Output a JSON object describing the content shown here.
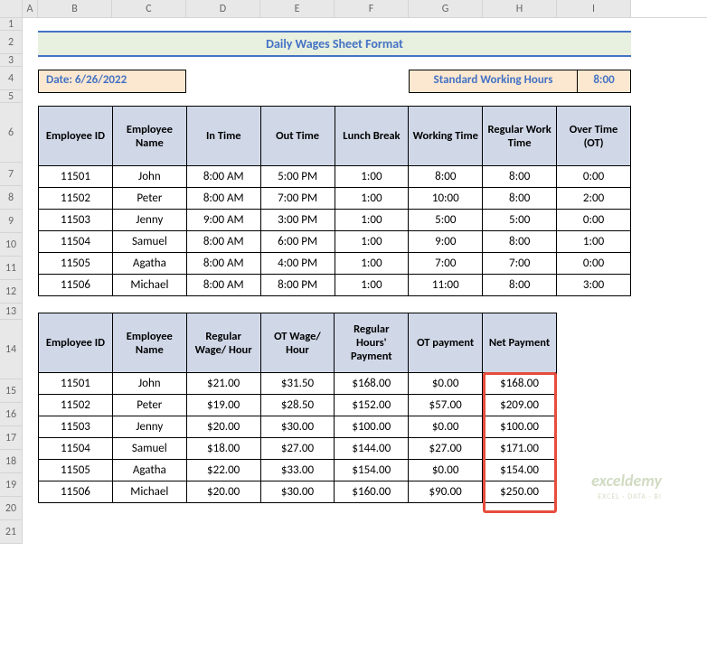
{
  "columns": [
    "A",
    "B",
    "C",
    "D",
    "E",
    "F",
    "G",
    "H",
    "I"
  ],
  "rowNums": [
    "1",
    "2",
    "3",
    "4",
    "5",
    "6",
    "7",
    "8",
    "9",
    "10",
    "11",
    "12",
    "13",
    "14",
    "15",
    "16",
    "17",
    "18",
    "19",
    "20",
    "21"
  ],
  "title": "Daily Wages Sheet Format",
  "dateLabel": "Date: 6/26/2022",
  "stdHoursLabel": "Standard Working Hours",
  "stdHoursValue": "8:00",
  "table1": {
    "headers": [
      "Employee ID",
      "Employee Name",
      "In Time",
      "Out Time",
      "Lunch Break",
      "Working Time",
      "Regular Work Time",
      "Over Time (OT)"
    ],
    "rows": [
      [
        "11501",
        "John",
        "8:00 AM",
        "5:00 PM",
        "1:00",
        "8:00",
        "8:00",
        "0:00"
      ],
      [
        "11502",
        "Peter",
        "8:00 AM",
        "7:00 PM",
        "1:00",
        "10:00",
        "8:00",
        "2:00"
      ],
      [
        "11503",
        "Jenny",
        "9:00 AM",
        "3:00 PM",
        "1:00",
        "5:00",
        "5:00",
        "0:00"
      ],
      [
        "11504",
        "Samuel",
        "8:00 AM",
        "6:00 PM",
        "1:00",
        "9:00",
        "8:00",
        "1:00"
      ],
      [
        "11505",
        "Agatha",
        "8:00 AM",
        "4:00 PM",
        "1:00",
        "7:00",
        "7:00",
        "0:00"
      ],
      [
        "11506",
        "Michael",
        "8:00 AM",
        "8:00 PM",
        "1:00",
        "11:00",
        "8:00",
        "3:00"
      ]
    ]
  },
  "table2": {
    "headers": [
      "Employee ID",
      "Employee Name",
      "Regular Wage/ Hour",
      "OT Wage/ Hour",
      "Regular Hours' Payment",
      "OT payment",
      "Net Payment"
    ],
    "rows": [
      [
        "11501",
        "John",
        "$21.00",
        "$31.50",
        "$168.00",
        "$0.00",
        "$168.00"
      ],
      [
        "11502",
        "Peter",
        "$19.00",
        "$28.50",
        "$152.00",
        "$57.00",
        "$209.00"
      ],
      [
        "11503",
        "Jenny",
        "$20.00",
        "$30.00",
        "$100.00",
        "$0.00",
        "$100.00"
      ],
      [
        "11504",
        "Samuel",
        "$18.00",
        "$27.00",
        "$144.00",
        "$27.00",
        "$171.00"
      ],
      [
        "11505",
        "Agatha",
        "$22.00",
        "$33.00",
        "$154.00",
        "$0.00",
        "$154.00"
      ],
      [
        "11506",
        "Michael",
        "$20.00",
        "$30.00",
        "$160.00",
        "$90.00",
        "$250.00"
      ]
    ]
  },
  "watermark": "exceldemy",
  "watermarkSub": "EXCEL · DATA · BI",
  "chart_data": {
    "type": "table",
    "title": "Daily Wages Sheet Format",
    "tables": [
      {
        "headers": [
          "Employee ID",
          "Employee Name",
          "In Time",
          "Out Time",
          "Lunch Break",
          "Working Time",
          "Regular Work Time",
          "Over Time (OT)"
        ],
        "rows": [
          [
            11501,
            "John",
            "8:00 AM",
            "5:00 PM",
            "1:00",
            "8:00",
            "8:00",
            "0:00"
          ],
          [
            11502,
            "Peter",
            "8:00 AM",
            "7:00 PM",
            "1:00",
            "10:00",
            "8:00",
            "2:00"
          ],
          [
            11503,
            "Jenny",
            "9:00 AM",
            "3:00 PM",
            "1:00",
            "5:00",
            "5:00",
            "0:00"
          ],
          [
            11504,
            "Samuel",
            "8:00 AM",
            "6:00 PM",
            "1:00",
            "9:00",
            "8:00",
            "1:00"
          ],
          [
            11505,
            "Agatha",
            "8:00 AM",
            "4:00 PM",
            "1:00",
            "7:00",
            "7:00",
            "0:00"
          ],
          [
            11506,
            "Michael",
            "8:00 AM",
            "8:00 PM",
            "1:00",
            "11:00",
            "8:00",
            "3:00"
          ]
        ]
      },
      {
        "headers": [
          "Employee ID",
          "Employee Name",
          "Regular Wage/Hour",
          "OT Wage/Hour",
          "Regular Hours' Payment",
          "OT payment",
          "Net Payment"
        ],
        "rows": [
          [
            11501,
            "John",
            21.0,
            31.5,
            168.0,
            0.0,
            168.0
          ],
          [
            11502,
            "Peter",
            19.0,
            28.5,
            152.0,
            57.0,
            209.0
          ],
          [
            11503,
            "Jenny",
            20.0,
            30.0,
            100.0,
            0.0,
            100.0
          ],
          [
            11504,
            "Samuel",
            18.0,
            27.0,
            144.0,
            27.0,
            171.0
          ],
          [
            11505,
            "Agatha",
            22.0,
            33.0,
            154.0,
            0.0,
            154.0
          ],
          [
            11506,
            "Michael",
            20.0,
            30.0,
            160.0,
            90.0,
            250.0
          ]
        ]
      }
    ]
  }
}
